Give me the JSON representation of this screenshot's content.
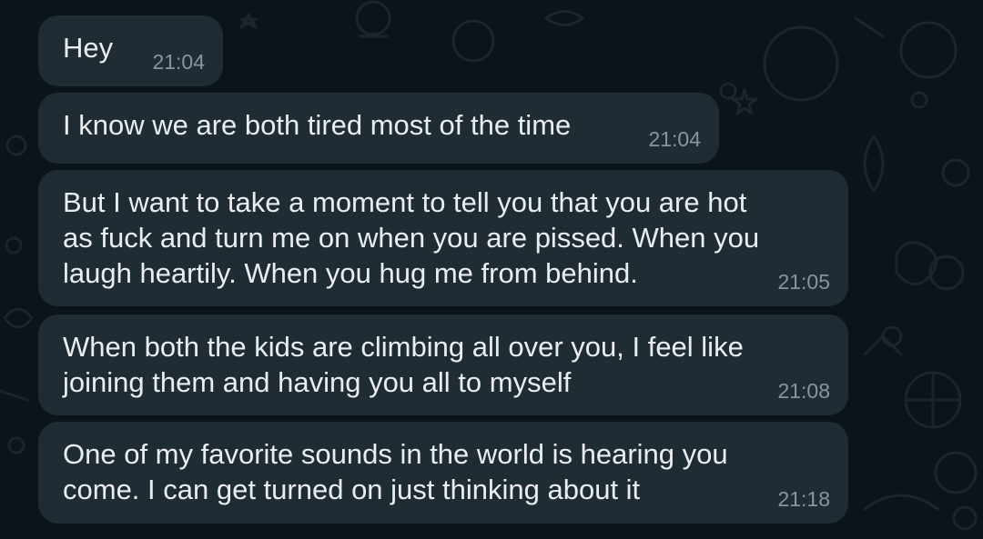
{
  "colors": {
    "background": "#0b141a",
    "bubble": "#202c33",
    "text": "#e9edef",
    "timestamp": "#8696a0"
  },
  "messages": [
    {
      "text": "Hey",
      "time": "21:04"
    },
    {
      "text": "I know we are both tired most of the time",
      "time": "21:04"
    },
    {
      "text": "But I want to take a moment to tell you that you are hot\nas fuck and turn me on when you are pissed. When you\nlaugh heartily. When you hug me from behind.",
      "time": "21:05"
    },
    {
      "text": "When both the kids are climbing all over you, I feel like\njoining them and having you all to myself",
      "time": "21:08"
    },
    {
      "text": "One of my favorite sounds in the world is hearing you\ncome. I can get turned on just thinking about it",
      "time": "21:18"
    }
  ]
}
